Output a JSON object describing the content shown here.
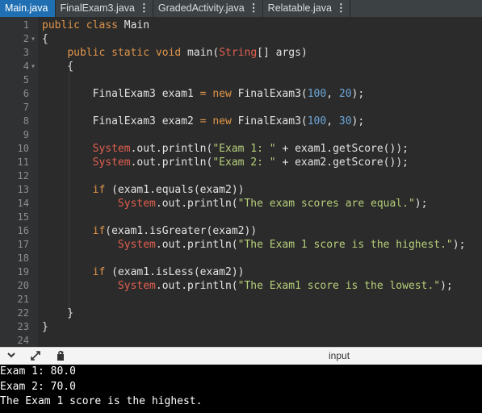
{
  "tabs": [
    {
      "label": "Main.java",
      "active": true,
      "menu": false
    },
    {
      "label": "FinalExam3.java",
      "active": false,
      "menu": true
    },
    {
      "label": "GradedActivity.java",
      "active": false,
      "menu": true
    },
    {
      "label": "Relatable.java",
      "active": false,
      "menu": true
    }
  ],
  "colors": {
    "active_tab": "#1f6fb2",
    "keyword": "#e0954a",
    "system": "#e25f4f",
    "string": "#b6cf7a",
    "number": "#6aa6d8"
  },
  "code": {
    "line_numbers": [
      "1",
      "2",
      "3",
      "4",
      "5",
      "6",
      "7",
      "8",
      "9",
      "10",
      "11",
      "12",
      "13",
      "14",
      "15",
      "16",
      "17",
      "18",
      "19",
      "20",
      "21",
      "22",
      "23",
      "24"
    ],
    "fold_markers": {
      "2": "▾",
      "4": "▾"
    },
    "lines": [
      {
        "n": "1",
        "segments": [
          [
            "kw",
            "public "
          ],
          [
            "kw",
            "class "
          ],
          [
            "cls",
            "Main"
          ]
        ]
      },
      {
        "n": "2",
        "segments": [
          [
            "cls",
            "{"
          ]
        ]
      },
      {
        "n": "3",
        "segments": [
          [
            "cls",
            "    "
          ],
          [
            "kw",
            "public "
          ],
          [
            "kw",
            "static "
          ],
          [
            "kw",
            "void "
          ],
          [
            "cls",
            "main("
          ],
          [
            "sys",
            "String"
          ],
          [
            "cls",
            "[] args)"
          ]
        ]
      },
      {
        "n": "4",
        "segments": [
          [
            "cls",
            "    {"
          ]
        ]
      },
      {
        "n": "5",
        "segments": []
      },
      {
        "n": "6",
        "segments": [
          [
            "cls",
            "        FinalExam3 exam1 "
          ],
          [
            "eq",
            "= "
          ],
          [
            "kw",
            "new "
          ],
          [
            "cls",
            "FinalExam3("
          ],
          [
            "num",
            "100"
          ],
          [
            "cls",
            ", "
          ],
          [
            "num",
            "20"
          ],
          [
            "cls",
            ");"
          ]
        ]
      },
      {
        "n": "7",
        "segments": []
      },
      {
        "n": "8",
        "segments": [
          [
            "cls",
            "        FinalExam3 exam2 "
          ],
          [
            "eq",
            "= "
          ],
          [
            "kw",
            "new "
          ],
          [
            "cls",
            "FinalExam3("
          ],
          [
            "num",
            "100"
          ],
          [
            "cls",
            ", "
          ],
          [
            "num",
            "30"
          ],
          [
            "cls",
            ");"
          ]
        ]
      },
      {
        "n": "9",
        "segments": []
      },
      {
        "n": "10",
        "segments": [
          [
            "cls",
            "        "
          ],
          [
            "sys",
            "System"
          ],
          [
            "cls",
            ".out.println("
          ],
          [
            "str",
            "\"Exam 1: \""
          ],
          [
            "cls",
            " + exam1.getScore());"
          ]
        ]
      },
      {
        "n": "11",
        "segments": [
          [
            "cls",
            "        "
          ],
          [
            "sys",
            "System"
          ],
          [
            "cls",
            ".out.println("
          ],
          [
            "str",
            "\"Exam 2: \""
          ],
          [
            "cls",
            " + exam2.getScore());"
          ]
        ]
      },
      {
        "n": "12",
        "segments": []
      },
      {
        "n": "13",
        "segments": [
          [
            "cls",
            "        "
          ],
          [
            "kw",
            "if "
          ],
          [
            "cls",
            "(exam1.equals(exam2))"
          ]
        ]
      },
      {
        "n": "14",
        "segments": [
          [
            "cls",
            "            "
          ],
          [
            "sys",
            "System"
          ],
          [
            "cls",
            ".out.println("
          ],
          [
            "str",
            "\"The exam scores are equal.\""
          ],
          [
            "cls",
            ");"
          ]
        ]
      },
      {
        "n": "15",
        "segments": []
      },
      {
        "n": "16",
        "segments": [
          [
            "cls",
            "        "
          ],
          [
            "kw",
            "if"
          ],
          [
            "cls",
            "(exam1.isGreater(exam2))"
          ]
        ]
      },
      {
        "n": "17",
        "segments": [
          [
            "cls",
            "            "
          ],
          [
            "sys",
            "System"
          ],
          [
            "cls",
            ".out.println("
          ],
          [
            "str",
            "\"The Exam 1 score is the highest.\""
          ],
          [
            "cls",
            ");"
          ]
        ]
      },
      {
        "n": "18",
        "segments": []
      },
      {
        "n": "19",
        "segments": [
          [
            "cls",
            "        "
          ],
          [
            "kw",
            "if "
          ],
          [
            "cls",
            "(exam1.isLess(exam2))"
          ]
        ]
      },
      {
        "n": "20",
        "segments": [
          [
            "cls",
            "            "
          ],
          [
            "sys",
            "System"
          ],
          [
            "cls",
            ".out.println("
          ],
          [
            "str",
            "\"The Exam1 score is the lowest.\""
          ],
          [
            "cls",
            ");"
          ]
        ]
      },
      {
        "n": "21",
        "segments": []
      },
      {
        "n": "22",
        "segments": [
          [
            "cls",
            "    }"
          ]
        ]
      },
      {
        "n": "23",
        "segments": [
          [
            "cls",
            "}"
          ]
        ]
      },
      {
        "n": "24",
        "segments": []
      }
    ]
  },
  "console_bar": {
    "icons": [
      "chevron-down-icon",
      "expand-icon",
      "share-icon"
    ],
    "label": "input"
  },
  "console_output": [
    "Exam 1: 80.0",
    "Exam 2: 70.0",
    "The Exam 1 score is the highest."
  ]
}
